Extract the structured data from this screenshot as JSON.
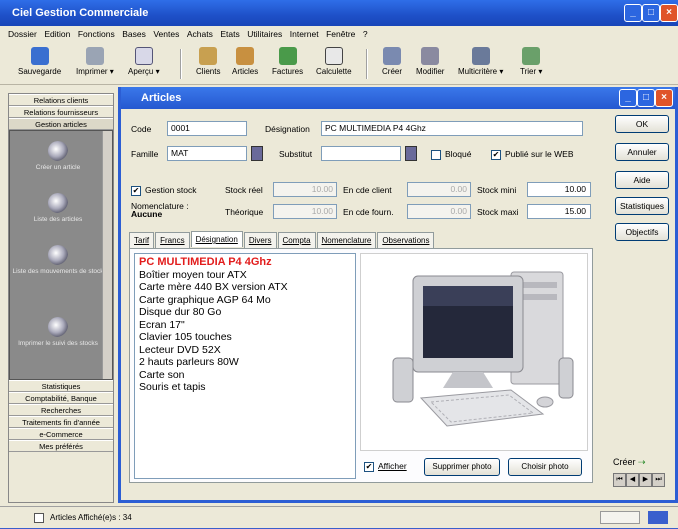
{
  "window": {
    "title": "Ciel Gestion Commerciale"
  },
  "menu": [
    "Dossier",
    "Edition",
    "Fonctions",
    "Bases",
    "Ventes",
    "Achats",
    "Etats",
    "Utilitaires",
    "Internet",
    "Fenêtre",
    "?"
  ],
  "toolbar": {
    "sauvegarde": "Sauvegarde",
    "imprimer": "Imprimer",
    "apercu": "Aperçu",
    "clients": "Clients",
    "articles": "Articles",
    "factures": "Factures",
    "calculette": "Calculette",
    "creer": "Créer",
    "modifier": "Modifier",
    "multicritere": "Multicritère",
    "trier": "Trier"
  },
  "sidebar": {
    "top": [
      "Relations clients",
      "Relations fournisseurs",
      "Gestion articles"
    ],
    "items": [
      "Créer un article",
      "Liste des articles",
      "Liste des mouvements de stock",
      "Imprimer le suivi des stocks"
    ],
    "bottom": [
      "Statistiques",
      "Comptabilité, Banque",
      "Recherches",
      "Traitements fin d'année",
      "e-Commerce",
      "Mes préférés"
    ]
  },
  "articles": {
    "title": "Articles",
    "code_label": "Code",
    "code": "0001",
    "designation_label": "Désignation",
    "designation": "PC MULTIMEDIA P4 4Ghz",
    "famille_label": "Famille",
    "famille": "MAT",
    "substitut_label": "Substitut",
    "substitut": "",
    "bloque_label": "Bloqué",
    "publie_label": "Publié sur le WEB",
    "gestion_stock_label": "Gestion stock",
    "nomenclature_label": "Nomenclature :",
    "nomenclature": "Aucune",
    "stock_reel_label": "Stock réel",
    "stock_reel": "10.00",
    "theorique_label": "Théorique",
    "theorique": "10.00",
    "cde_client_label": "En cde client",
    "cde_client": "0.00",
    "cde_fourn_label": "En cde fourn.",
    "cde_fourn": "0.00",
    "stock_mini_label": "Stock mini",
    "stock_mini": "10.00",
    "stock_maxi_label": "Stock maxi",
    "stock_maxi": "15.00",
    "tabs": [
      "Tarif",
      "Francs",
      "Désignation",
      "Divers",
      "Compta",
      "Nomenclature",
      "Observations"
    ],
    "desc_title": "PC MULTIMEDIA P4 4Ghz",
    "desc_lines": [
      "Boîtier moyen tour ATX",
      "Carte mère 440 BX version ATX",
      "Carte graphique AGP 64 Mo",
      "Disque dur 80 Go",
      "Ecran 17\"",
      "Clavier 105 touches",
      "Lecteur DVD 52X",
      "2 hauts parleurs 80W",
      "Carte son",
      "Souris et tapis"
    ],
    "afficher": "Afficher",
    "supprimer_photo": "Supprimer photo",
    "choisir_photo": "Choisir photo",
    "buttons": {
      "ok": "OK",
      "annuler": "Annuler",
      "aide": "Aide",
      "statistiques": "Statistiques",
      "objectifs": "Objectifs"
    },
    "creer": "Créer"
  },
  "status": {
    "text": "Articles Affiché(e)s : 34"
  }
}
